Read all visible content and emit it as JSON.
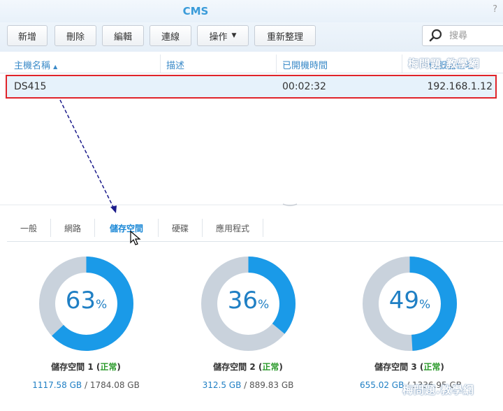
{
  "window": {
    "title": "CMS",
    "help": "?"
  },
  "toolbar": {
    "add": "新增",
    "delete": "刪除",
    "edit": "編輯",
    "connect": "連線",
    "actions": "操作",
    "reorder": "重新整理"
  },
  "search": {
    "placeholder": "搜尋"
  },
  "grid": {
    "columns": [
      "主機名稱",
      "描述",
      "已開機時間",
      "伺服器位址"
    ],
    "sort_indicator": "▲",
    "rows": [
      {
        "hostname": "DS415",
        "description": "",
        "uptime": "00:02:32",
        "address": "192.168.1.12"
      }
    ]
  },
  "watermark": {
    "top": "梅問題.教學網",
    "bottom": "梅問題.教學網"
  },
  "tabs": [
    "一般",
    "網路",
    "儲存空間",
    "硬碟",
    "應用程式"
  ],
  "active_tab": "儲存空間",
  "colors": {
    "accent": "#1b88d6",
    "donut_used": "#1a9ae8",
    "donut_free": "#c9d2dc",
    "ok": "#2a9a2a",
    "highlight_border": "#e0242a"
  },
  "volumes": [
    {
      "name": "儲存空間 1",
      "status": "正常",
      "percent": 63,
      "percent_text": "63",
      "used": "1117.58 GB",
      "total": "/ 1784.08 GB"
    },
    {
      "name": "儲存空間 2",
      "status": "正常",
      "percent": 36,
      "percent_text": "36",
      "used": "312.5 GB",
      "total": "/ 889.83 GB"
    },
    {
      "name": "儲存空間 3",
      "status": "正常",
      "percent": 49,
      "percent_text": "49",
      "used": "655.02 GB",
      "total": "/ 1336.95 GB"
    }
  ],
  "labels": {
    "percent_sign": "%",
    "open_paren": " (",
    "close_paren": ")"
  }
}
